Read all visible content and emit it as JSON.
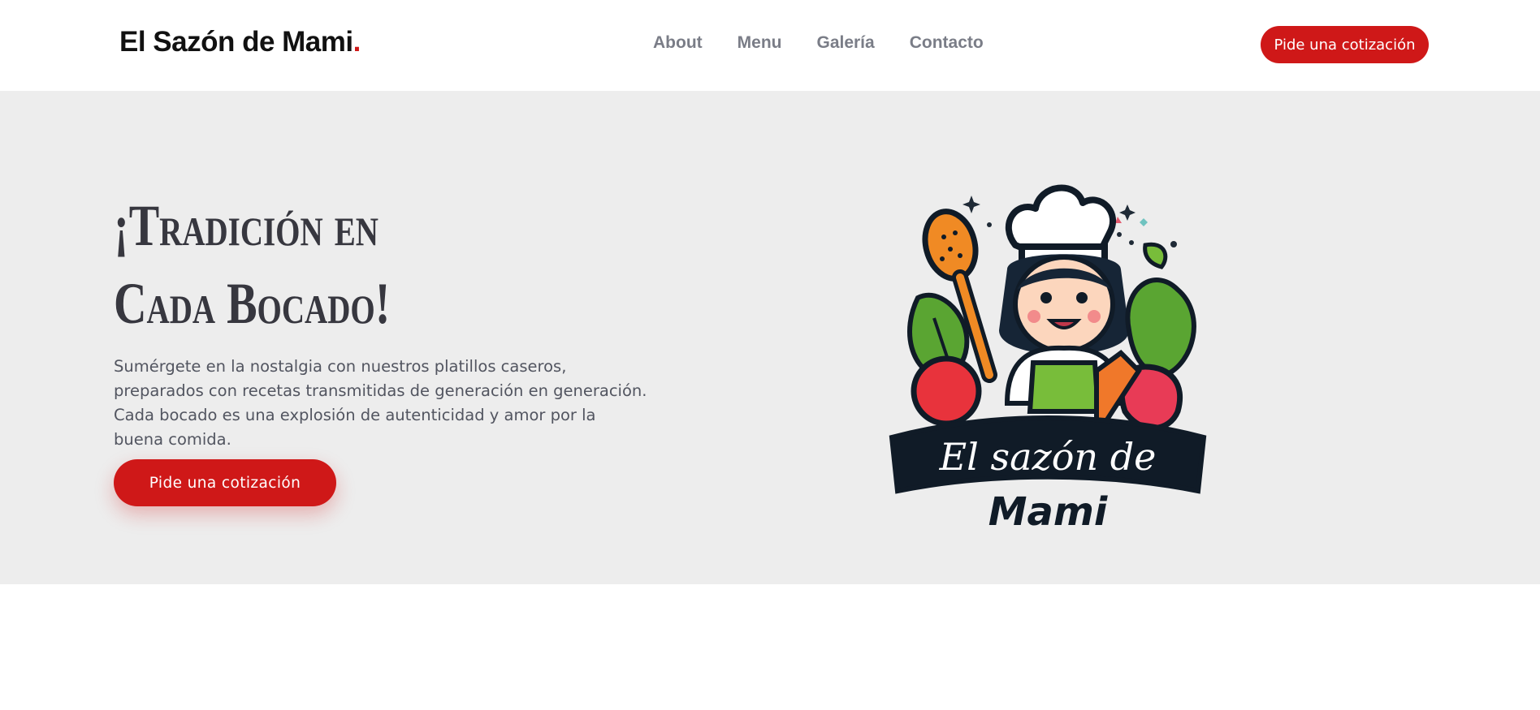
{
  "header": {
    "logo_text": "El Sazón de Mami",
    "logo_dot": ".",
    "nav": [
      {
        "label": "About"
      },
      {
        "label": "Menu"
      },
      {
        "label": "Galería"
      },
      {
        "label": "Contacto"
      }
    ],
    "cta_label": "Pide una cotización"
  },
  "hero": {
    "title": "¡Tradición en Cada Bocado!",
    "description": "Sumérgete en la nostalgia con nuestros platillos caseros, preparados con recetas transmitidas de generación en generación. Cada bocado es una explosión de autenticidad y amor por la buena comida.",
    "cta_label": "Pide una cotización",
    "logo_line1": "El sazón de",
    "logo_line2": "Mami"
  },
  "colors": {
    "accent": "#cf1818",
    "hero_background": "#ededed",
    "nav_text": "#7a7d87"
  }
}
